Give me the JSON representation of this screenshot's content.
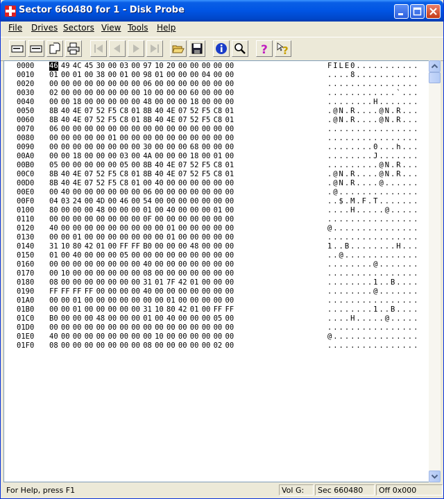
{
  "window": {
    "title": "Sector 660480 for 1 - Disk Probe"
  },
  "menu": [
    "File",
    "Drives",
    "Sectors",
    "View",
    "Tools",
    "Help"
  ],
  "toolbar_icons": [
    "properties-icon",
    "properties-icon",
    "copy-icon",
    "print-icon",
    "first-sector-icon",
    "previous-sector-icon",
    "next-sector-icon",
    "last-sector-icon",
    "open-icon",
    "save-icon",
    "info-icon",
    "find-icon",
    "help-icon",
    "context-help-icon"
  ],
  "hex_rows": [
    {
      "offset": "0000",
      "bytes": [
        "46",
        "49",
        "4C",
        "45",
        "30",
        "00",
        "03",
        "00",
        "97",
        "10",
        "20",
        "00",
        "00",
        "00",
        "00",
        "00"
      ],
      "ascii": "FILE0..........."
    },
    {
      "offset": "0010",
      "bytes": [
        "01",
        "00",
        "01",
        "00",
        "38",
        "00",
        "01",
        "00",
        "98",
        "01",
        "00",
        "00",
        "00",
        "04",
        "00",
        "00"
      ],
      "ascii": "....8..........."
    },
    {
      "offset": "0020",
      "bytes": [
        "00",
        "00",
        "00",
        "00",
        "00",
        "00",
        "00",
        "00",
        "06",
        "00",
        "00",
        "00",
        "00",
        "00",
        "00",
        "00"
      ],
      "ascii": "................"
    },
    {
      "offset": "0030",
      "bytes": [
        "02",
        "00",
        "00",
        "00",
        "00",
        "00",
        "00",
        "00",
        "10",
        "00",
        "00",
        "00",
        "60",
        "00",
        "00",
        "00"
      ],
      "ascii": "............`..."
    },
    {
      "offset": "0040",
      "bytes": [
        "00",
        "00",
        "18",
        "00",
        "00",
        "00",
        "00",
        "00",
        "48",
        "00",
        "00",
        "00",
        "18",
        "00",
        "00",
        "00"
      ],
      "ascii": "........H......."
    },
    {
      "offset": "0050",
      "bytes": [
        "8B",
        "40",
        "4E",
        "07",
        "52",
        "F5",
        "C8",
        "01",
        "8B",
        "40",
        "4E",
        "07",
        "52",
        "F5",
        "C8",
        "01"
      ],
      "ascii": ".@N.R....@N.R..."
    },
    {
      "offset": "0060",
      "bytes": [
        "8B",
        "40",
        "4E",
        "07",
        "52",
        "F5",
        "C8",
        "01",
        "8B",
        "40",
        "4E",
        "07",
        "52",
        "F5",
        "C8",
        "01"
      ],
      "ascii": ".@N.R....@N.R..."
    },
    {
      "offset": "0070",
      "bytes": [
        "06",
        "00",
        "00",
        "00",
        "00",
        "00",
        "00",
        "00",
        "00",
        "00",
        "00",
        "00",
        "00",
        "00",
        "00",
        "00"
      ],
      "ascii": "................"
    },
    {
      "offset": "0080",
      "bytes": [
        "00",
        "00",
        "00",
        "00",
        "00",
        "01",
        "00",
        "00",
        "00",
        "00",
        "00",
        "00",
        "00",
        "00",
        "00",
        "00"
      ],
      "ascii": "................"
    },
    {
      "offset": "0090",
      "bytes": [
        "00",
        "00",
        "00",
        "00",
        "00",
        "00",
        "00",
        "00",
        "30",
        "00",
        "00",
        "00",
        "68",
        "00",
        "00",
        "00"
      ],
      "ascii": "........0...h..."
    },
    {
      "offset": "00A0",
      "bytes": [
        "00",
        "00",
        "18",
        "00",
        "00",
        "00",
        "03",
        "00",
        "4A",
        "00",
        "00",
        "00",
        "18",
        "00",
        "01",
        "00"
      ],
      "ascii": "........J......."
    },
    {
      "offset": "00B0",
      "bytes": [
        "05",
        "00",
        "00",
        "00",
        "00",
        "00",
        "05",
        "00",
        "8B",
        "40",
        "4E",
        "07",
        "52",
        "F5",
        "C8",
        "01"
      ],
      "ascii": ".........@N.R..."
    },
    {
      "offset": "00C0",
      "bytes": [
        "8B",
        "40",
        "4E",
        "07",
        "52",
        "F5",
        "C8",
        "01",
        "8B",
        "40",
        "4E",
        "07",
        "52",
        "F5",
        "C8",
        "01"
      ],
      "ascii": ".@N.R....@N.R..."
    },
    {
      "offset": "00D0",
      "bytes": [
        "8B",
        "40",
        "4E",
        "07",
        "52",
        "F5",
        "C8",
        "01",
        "00",
        "40",
        "00",
        "00",
        "00",
        "00",
        "00",
        "00"
      ],
      "ascii": ".@N.R....@......"
    },
    {
      "offset": "00E0",
      "bytes": [
        "00",
        "40",
        "00",
        "00",
        "00",
        "00",
        "00",
        "00",
        "06",
        "00",
        "00",
        "00",
        "00",
        "00",
        "00",
        "00"
      ],
      "ascii": ".@.............."
    },
    {
      "offset": "00F0",
      "bytes": [
        "04",
        "03",
        "24",
        "00",
        "4D",
        "00",
        "46",
        "00",
        "54",
        "00",
        "00",
        "00",
        "00",
        "00",
        "00",
        "00"
      ],
      "ascii": "..$.M.F.T......."
    },
    {
      "offset": "0100",
      "bytes": [
        "80",
        "00",
        "00",
        "00",
        "48",
        "00",
        "00",
        "00",
        "01",
        "00",
        "40",
        "00",
        "00",
        "00",
        "01",
        "00"
      ],
      "ascii": "....H.....@....."
    },
    {
      "offset": "0110",
      "bytes": [
        "00",
        "00",
        "00",
        "00",
        "00",
        "00",
        "00",
        "00",
        "0F",
        "00",
        "00",
        "00",
        "00",
        "00",
        "00",
        "00"
      ],
      "ascii": "................"
    },
    {
      "offset": "0120",
      "bytes": [
        "40",
        "00",
        "00",
        "00",
        "00",
        "00",
        "00",
        "00",
        "00",
        "00",
        "01",
        "00",
        "00",
        "00",
        "00",
        "00"
      ],
      "ascii": "@..............."
    },
    {
      "offset": "0130",
      "bytes": [
        "00",
        "00",
        "01",
        "00",
        "00",
        "00",
        "00",
        "00",
        "00",
        "00",
        "01",
        "00",
        "00",
        "00",
        "00",
        "00"
      ],
      "ascii": "................"
    },
    {
      "offset": "0140",
      "bytes": [
        "31",
        "10",
        "80",
        "42",
        "01",
        "00",
        "FF",
        "FF",
        "B0",
        "00",
        "00",
        "00",
        "48",
        "00",
        "00",
        "00"
      ],
      "ascii": "1..B........H..."
    },
    {
      "offset": "0150",
      "bytes": [
        "01",
        "00",
        "40",
        "00",
        "00",
        "00",
        "05",
        "00",
        "00",
        "00",
        "00",
        "00",
        "00",
        "00",
        "00",
        "00"
      ],
      "ascii": "..@............."
    },
    {
      "offset": "0160",
      "bytes": [
        "00",
        "00",
        "00",
        "00",
        "00",
        "00",
        "00",
        "00",
        "40",
        "00",
        "00",
        "00",
        "00",
        "00",
        "00",
        "00"
      ],
      "ascii": "........@......."
    },
    {
      "offset": "0170",
      "bytes": [
        "00",
        "10",
        "00",
        "00",
        "00",
        "00",
        "00",
        "00",
        "08",
        "00",
        "00",
        "00",
        "00",
        "00",
        "00",
        "00"
      ],
      "ascii": "................"
    },
    {
      "offset": "0180",
      "bytes": [
        "08",
        "00",
        "00",
        "00",
        "00",
        "00",
        "00",
        "00",
        "31",
        "01",
        "7F",
        "42",
        "01",
        "00",
        "00",
        "00"
      ],
      "ascii": "........1..B...."
    },
    {
      "offset": "0190",
      "bytes": [
        "FF",
        "FF",
        "FF",
        "FF",
        "00",
        "00",
        "00",
        "00",
        "40",
        "00",
        "00",
        "00",
        "00",
        "00",
        "00",
        "00"
      ],
      "ascii": "........@......."
    },
    {
      "offset": "01A0",
      "bytes": [
        "00",
        "00",
        "01",
        "00",
        "00",
        "00",
        "00",
        "00",
        "00",
        "00",
        "01",
        "00",
        "00",
        "00",
        "00",
        "00"
      ],
      "ascii": "................"
    },
    {
      "offset": "01B0",
      "bytes": [
        "00",
        "00",
        "01",
        "00",
        "00",
        "00",
        "00",
        "00",
        "31",
        "10",
        "80",
        "42",
        "01",
        "00",
        "FF",
        "FF"
      ],
      "ascii": "........1..B...."
    },
    {
      "offset": "01C0",
      "bytes": [
        "B0",
        "00",
        "00",
        "00",
        "48",
        "00",
        "00",
        "00",
        "01",
        "00",
        "40",
        "00",
        "00",
        "00",
        "05",
        "00"
      ],
      "ascii": "....H.....@....."
    },
    {
      "offset": "01D0",
      "bytes": [
        "00",
        "00",
        "00",
        "00",
        "00",
        "00",
        "00",
        "00",
        "00",
        "00",
        "00",
        "00",
        "00",
        "00",
        "00",
        "00"
      ],
      "ascii": "................"
    },
    {
      "offset": "01E0",
      "bytes": [
        "40",
        "00",
        "00",
        "00",
        "00",
        "00",
        "00",
        "00",
        "00",
        "10",
        "00",
        "00",
        "00",
        "00",
        "00",
        "00"
      ],
      "ascii": "@..............."
    },
    {
      "offset": "01F0",
      "bytes": [
        "08",
        "00",
        "00",
        "00",
        "00",
        "00",
        "00",
        "00",
        "08",
        "00",
        "00",
        "00",
        "00",
        "00",
        "02",
        "00"
      ],
      "ascii": "................"
    }
  ],
  "selected": {
    "row": 0,
    "col": 0
  },
  "statusbar": {
    "help": "For Help, press F1",
    "vol": "Vol  G:",
    "sector": "Sec 660480",
    "offset": "Off 0x000"
  }
}
